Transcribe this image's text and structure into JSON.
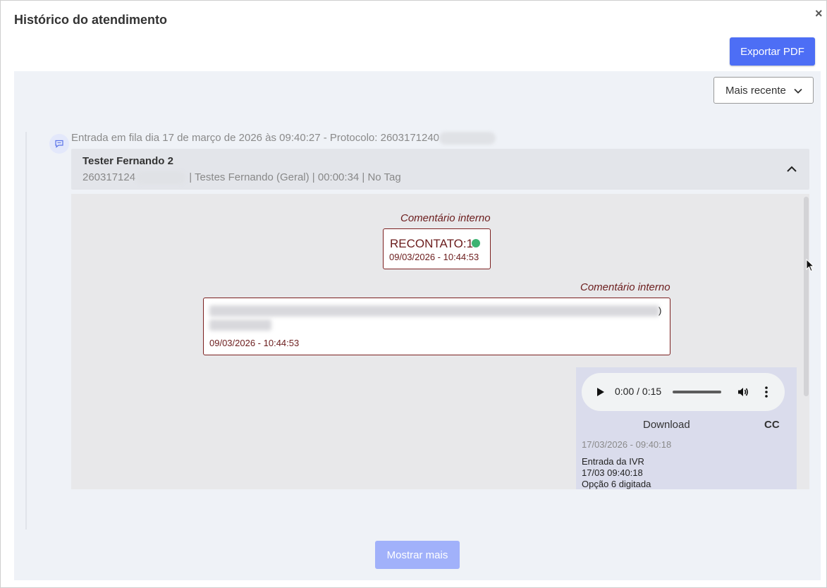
{
  "modal": {
    "title": "Histórico do atendimento",
    "close_glyph": "×"
  },
  "toolbar": {
    "export_label": "Exportar PDF",
    "accent_color": "#4d6ef5"
  },
  "sort": {
    "selected": "Mais recente"
  },
  "timeline": {
    "entry_text": "Entrada em fila dia 17 de março de 2026 às 09:40:27 - Protocolo: 2603171240",
    "entry_icon": "chat-bubble-icon",
    "card": {
      "name": "Tester Fernando 2",
      "protocol_prefix": "260317124",
      "details": "| Testes Fernando (Geral) | 00:00:34 | No Tag"
    }
  },
  "messages": [
    {
      "label": "Comentário interno",
      "text": "RECONTATO:1",
      "status_color": "#3cb371",
      "timestamp": "09/03/2026 - 10:44:53"
    },
    {
      "label": "Comentário interno",
      "text_end": ")",
      "timestamp": "09/03/2026 - 10:44:53"
    }
  ],
  "audio": {
    "time": "0:00 / 0:15",
    "download_label": "Download",
    "cc_label": "CC",
    "timestamp": "17/03/2026 - 09:40:18",
    "ivr_lines": [
      "Entrada da IVR",
      "17/03 09:40:18",
      "Opção 6 digitada"
    ]
  },
  "footer": {
    "show_more_label": "Mostrar mais"
  }
}
